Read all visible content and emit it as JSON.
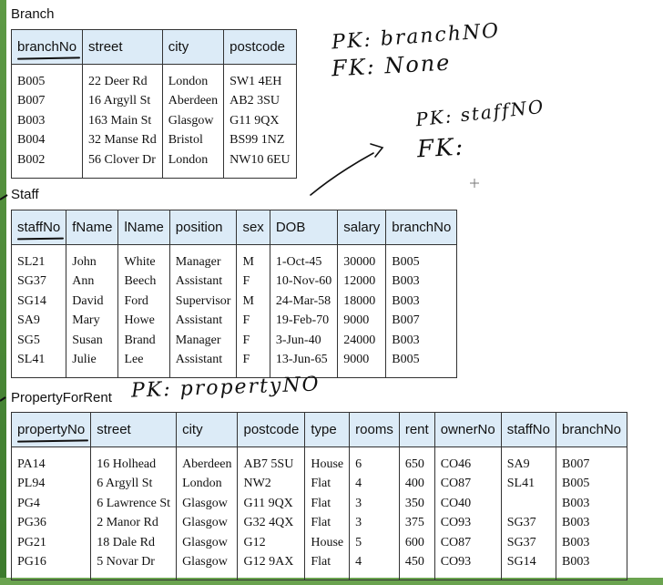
{
  "branch": {
    "title": "Branch",
    "columns": [
      "branchNo",
      "street",
      "city",
      "postcode"
    ],
    "rows": [
      [
        "B005",
        "22 Deer Rd",
        "London",
        "SW1 4EH"
      ],
      [
        "B007",
        "16 Argyll St",
        "Aberdeen",
        "AB2 3SU"
      ],
      [
        "B003",
        "163 Main St",
        "Glasgow",
        "G11 9QX"
      ],
      [
        "B004",
        "32 Manse Rd",
        "Bristol",
        "BS99 1NZ"
      ],
      [
        "B002",
        "56 Clover Dr",
        "London",
        "NW10 6EU"
      ]
    ]
  },
  "staff": {
    "title": "Staff",
    "columns": [
      "staffNo",
      "fName",
      "lName",
      "position",
      "sex",
      "DOB",
      "salary",
      "branchNo"
    ],
    "rows": [
      [
        "SL21",
        "John",
        "White",
        "Manager",
        "M",
        "1-Oct-45",
        "30000",
        "B005"
      ],
      [
        "SG37",
        "Ann",
        "Beech",
        "Assistant",
        "F",
        "10-Nov-60",
        "12000",
        "B003"
      ],
      [
        "SG14",
        "David",
        "Ford",
        "Supervisor",
        "M",
        "24-Mar-58",
        "18000",
        "B003"
      ],
      [
        "SA9",
        "Mary",
        "Howe",
        "Assistant",
        "F",
        "19-Feb-70",
        "9000",
        "B007"
      ],
      [
        "SG5",
        "Susan",
        "Brand",
        "Manager",
        "F",
        "3-Jun-40",
        "24000",
        "B003"
      ],
      [
        "SL41",
        "Julie",
        "Lee",
        "Assistant",
        "F",
        "13-Jun-65",
        "9000",
        "B005"
      ]
    ]
  },
  "property": {
    "title": "PropertyForRent",
    "columns": [
      "propertyNo",
      "street",
      "city",
      "postcode",
      "type",
      "rooms",
      "rent",
      "ownerNo",
      "staffNo",
      "branchNo"
    ],
    "rows": [
      [
        "PA14",
        "16 Holhead",
        "Aberdeen",
        "AB7 5SU",
        "House",
        "6",
        "650",
        "CO46",
        "SA9",
        "B007"
      ],
      [
        "PL94",
        "6 Argyll St",
        "London",
        "NW2",
        "Flat",
        "4",
        "400",
        "CO87",
        "SL41",
        "B005"
      ],
      [
        "PG4",
        "6 Lawrence St",
        "Glasgow",
        "G11 9QX",
        "Flat",
        "3",
        "350",
        "CO40",
        "",
        "B003"
      ],
      [
        "PG36",
        "2 Manor Rd",
        "Glasgow",
        "G32 4QX",
        "Flat",
        "3",
        "375",
        "CO93",
        "SG37",
        "B003"
      ],
      [
        "PG21",
        "18 Dale Rd",
        "Glasgow",
        "G12",
        "House",
        "5",
        "600",
        "CO87",
        "SG37",
        "B003"
      ],
      [
        "PG16",
        "5 Novar Dr",
        "Glasgow",
        "G12 9AX",
        "Flat",
        "4",
        "450",
        "CO93",
        "SG14",
        "B003"
      ]
    ]
  },
  "annotations": {
    "branch_pk": "PK: branchNO",
    "branch_fk": "FK: None",
    "staff_pk": "PK: staffNO",
    "staff_fk": "FK:",
    "property_pk": "PK: propertyNO"
  },
  "colors": {
    "header_bg": "#dcebf7",
    "border": "#333333",
    "slide_accent": "#5e9a45"
  }
}
